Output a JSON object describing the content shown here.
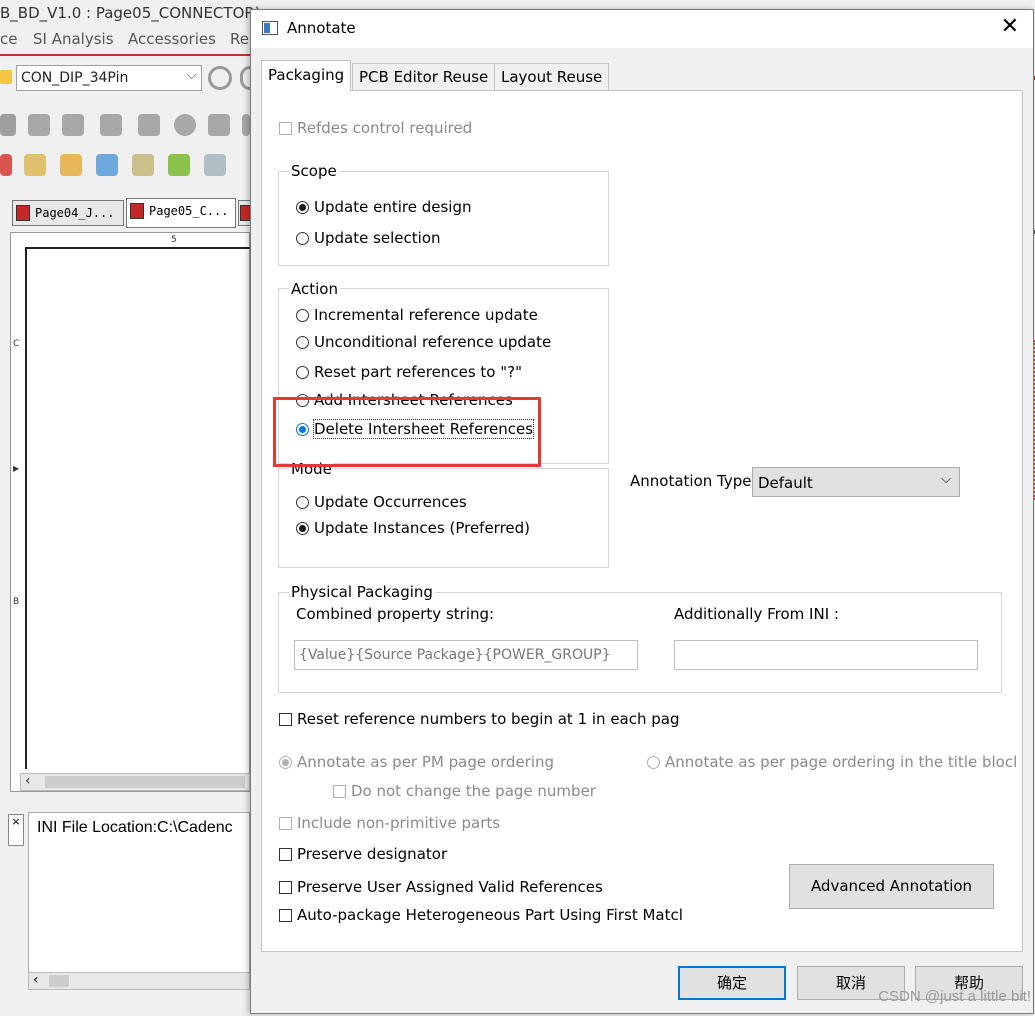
{
  "background_app": {
    "title_fragment": "B_BD_V1.0 : Page05_CONNECTOR)",
    "menu": [
      "ce",
      "SI Analysis",
      "Accessories",
      "Re"
    ],
    "part_combo_value": "CON_DIP_34Pin",
    "doc_tabs": [
      "Page04_J...",
      "Page05_C..."
    ],
    "canvas_marks": {
      "top": "5",
      "c": "C",
      "b": "B"
    },
    "output_text": "INI File Location:C:\\Cadenc"
  },
  "dialog": {
    "title": "Annotate",
    "tabs": [
      "Packaging",
      "PCB Editor Reuse",
      "Layout Reuse"
    ],
    "refdes_control": "Refdes control required",
    "scope": {
      "label": "Scope",
      "options": [
        "Update entire design",
        "Update selection"
      ],
      "selected": 0
    },
    "action": {
      "label": "Action",
      "options": [
        "Incremental reference update",
        "Unconditional reference update",
        "Reset part references to \"?\"",
        "Add Intersheet References",
        "Delete Intersheet References"
      ],
      "selected": 4
    },
    "mode": {
      "label": "Mode",
      "options": [
        "Update Occurrences",
        "Update Instances (Preferred)"
      ],
      "selected": 1
    },
    "annotation_type": {
      "label": "Annotation Type",
      "value": "Default"
    },
    "physical_packaging": {
      "label": "Physical Packaging",
      "combined_label": "Combined property string:",
      "combined_value": "{Value}{Source Package}{POWER_GROUP}",
      "additional_label": "Additionally From INI :",
      "additional_value": ""
    },
    "reset_numbers": "Reset reference numbers to begin at 1 in each pag",
    "annotate_pm": "Annotate as per PM page ordering",
    "annotate_title": "Annotate as per page ordering in the title blocl",
    "do_not_change": "Do not change the page number",
    "include_nonprimitive": "Include non-primitive parts",
    "preserve_designator": "Preserve designator",
    "preserve_valid": "Preserve User Assigned Valid References",
    "auto_package": "Auto-package Heterogeneous Part Using First Matcl",
    "advanced_button": "Advanced Annotation",
    "buttons": {
      "ok": "确定",
      "cancel": "取消",
      "help": "帮助"
    }
  },
  "watermark": "CSDN @just a little bit!",
  "colors": {
    "highlight": "#e53935",
    "accent": "#0078d7"
  }
}
